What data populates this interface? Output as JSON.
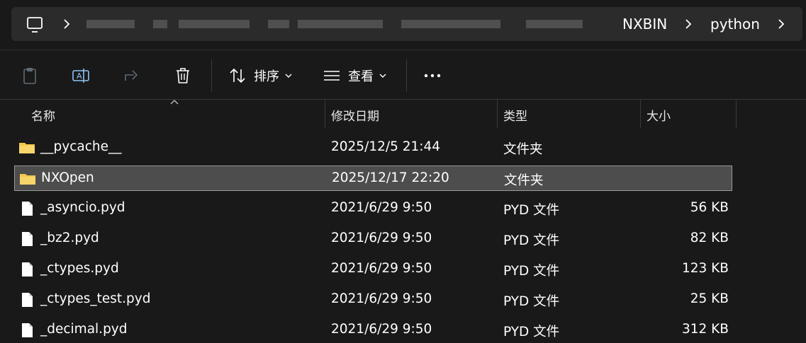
{
  "address_bar": {
    "crumbs": [
      "NXBIN",
      "python"
    ]
  },
  "toolbar": {
    "sort_label": "排序",
    "view_label": "查看"
  },
  "columns": {
    "name": "名称",
    "date": "修改日期",
    "type": "类型",
    "size": "大小"
  },
  "files": [
    {
      "name": "__pycache__",
      "date": "2025/12/5 21:44",
      "type": "文件夹",
      "size": "",
      "icon": "folder-icon",
      "selected": false
    },
    {
      "name": "NXOpen",
      "date": "2025/12/17 22:20",
      "type": "文件夹",
      "size": "",
      "icon": "folder-icon",
      "selected": true
    },
    {
      "name": "_asyncio.pyd",
      "date": "2021/6/29 9:50",
      "type": "PYD 文件",
      "size": "56 KB",
      "icon": "file-icon",
      "selected": false
    },
    {
      "name": "_bz2.pyd",
      "date": "2021/6/29 9:50",
      "type": "PYD 文件",
      "size": "82 KB",
      "icon": "file-icon",
      "selected": false
    },
    {
      "name": "_ctypes.pyd",
      "date": "2021/6/29 9:50",
      "type": "PYD 文件",
      "size": "123 KB",
      "icon": "file-icon",
      "selected": false
    },
    {
      "name": "_ctypes_test.pyd",
      "date": "2021/6/29 9:50",
      "type": "PYD 文件",
      "size": "25 KB",
      "icon": "file-icon",
      "selected": false
    },
    {
      "name": "_decimal.pyd",
      "date": "2021/6/29 9:50",
      "type": "PYD 文件",
      "size": "312 KB",
      "icon": "file-icon",
      "selected": false
    }
  ],
  "colors": {
    "background": "#191919",
    "selected_row": "#4d4d4d",
    "folder": "#f4c84a"
  }
}
